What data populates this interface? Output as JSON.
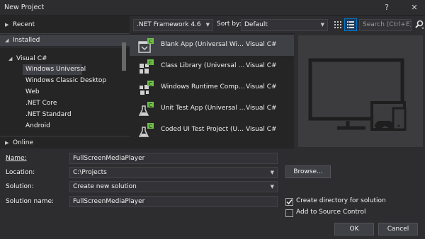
{
  "window": {
    "title": "New Project",
    "help_glyph": "?",
    "close_glyph": "✕"
  },
  "left_nav": {
    "recent": "Recent",
    "installed": "Installed",
    "visual_csharp": "Visual C#",
    "items": [
      "Windows Universal",
      "Windows Classic Desktop",
      "Web",
      ".NET Core",
      ".NET Standard",
      "Android"
    ],
    "online": "Online"
  },
  "toolbar": {
    "framework": ".NET Framework 4.6",
    "sort_label": "Sort by:",
    "sort_value": "Default",
    "search_placeholder": "Search (Ctrl+E)"
  },
  "templates": [
    {
      "name": "Blank App (Universal Windows)",
      "lang": "Visual C#",
      "icon": "blank-app-icon"
    },
    {
      "name": "Class Library (Universal Windows)",
      "lang": "Visual C#",
      "icon": "class-library-icon"
    },
    {
      "name": "Windows Runtime Component (Universal Windows)",
      "lang": "Visual C#",
      "icon": "runtime-component-icon"
    },
    {
      "name": "Unit Test App (Universal Windows)",
      "lang": "Visual C#",
      "icon": "unit-test-icon"
    },
    {
      "name": "Coded UI Test Project (Universal Windows)",
      "lang": "Visual C#",
      "icon": "coded-ui-test-icon"
    }
  ],
  "form": {
    "name_label": "Name:",
    "name_value": "FullScreenMediaPlayer",
    "location_label": "Location:",
    "location_value": "C:\\Projects",
    "solution_label": "Solution:",
    "solution_value": "Create new solution",
    "solution_name_label": "Solution name:",
    "solution_name_value": "FullScreenMediaPlayer",
    "browse": "Browse...",
    "create_dir": "Create directory for solution",
    "create_dir_checked": true,
    "source_control": "Add to Source Control",
    "source_control_checked": false,
    "ok": "OK",
    "cancel": "Cancel"
  },
  "colors": {
    "background": "#2d2d30",
    "panel": "#252526",
    "selection": "#3f3f46",
    "accent": "#007acc",
    "badge_green": "#6fbf4a"
  }
}
